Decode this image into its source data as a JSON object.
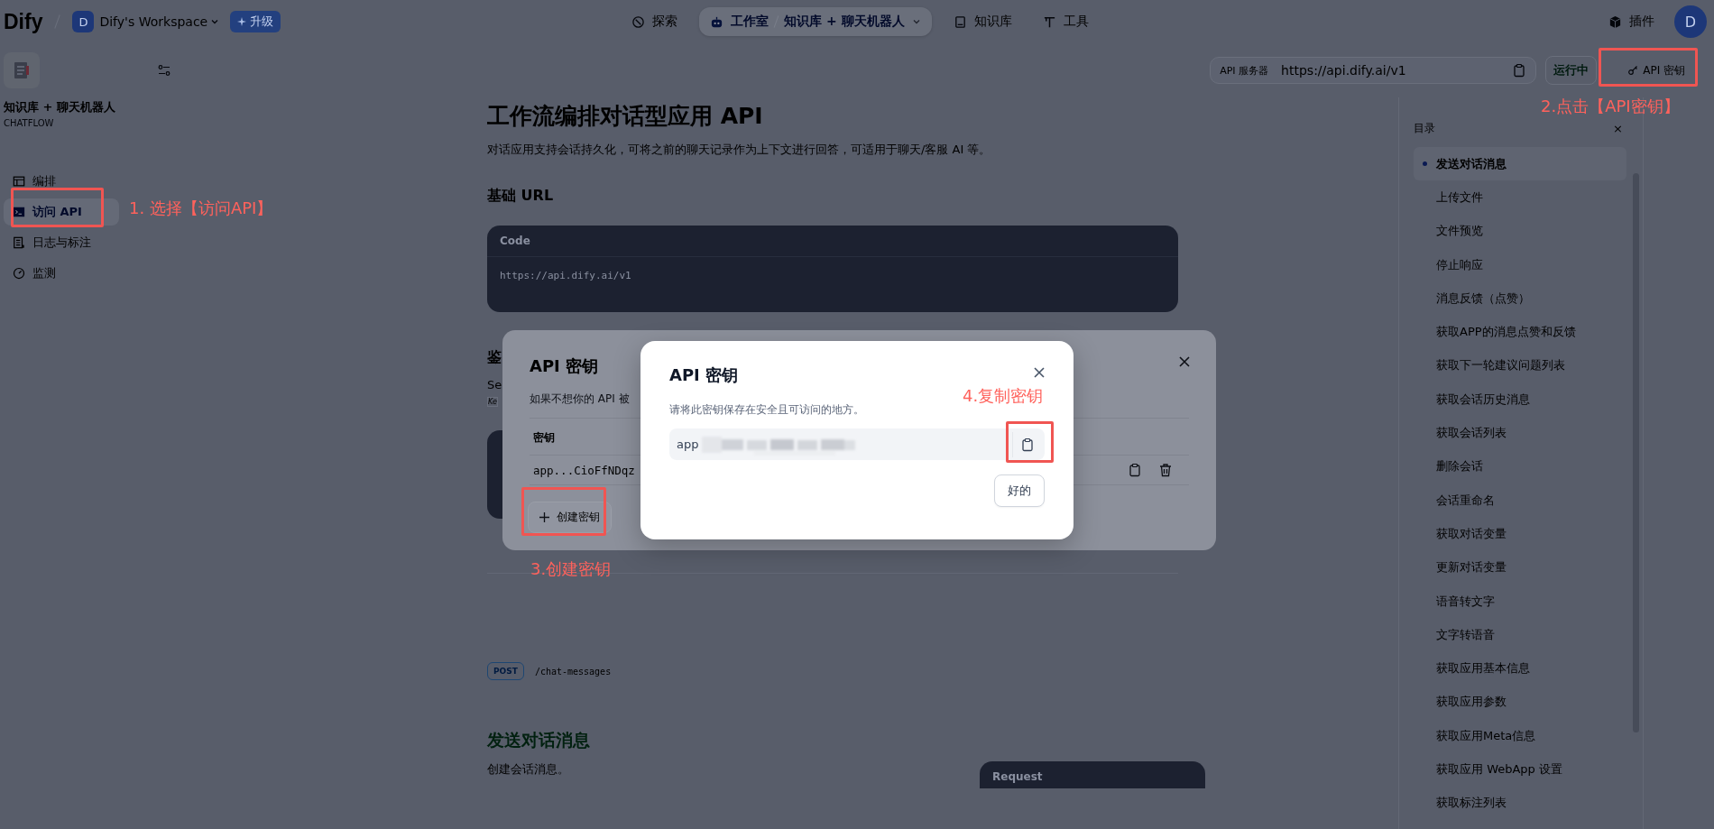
{
  "top_bar": {
    "logo": "Dify",
    "workspace_initial": "D",
    "workspace": "Dify's Workspace",
    "upgrade": "升级",
    "nav": [
      {
        "label": "探索",
        "selected": false
      },
      {
        "label": "工作室",
        "selected": true,
        "app": "知识库 + 聊天机器人"
      },
      {
        "label": "知识库",
        "selected": false
      },
      {
        "label": "工具",
        "selected": false
      }
    ],
    "plugins": "插件",
    "avatar": "D"
  },
  "sidebar": {
    "app_name": "知识库 + 聊天机器人",
    "app_type": "CHATFLOW",
    "items": [
      {
        "label": "编排",
        "selected": false
      },
      {
        "label": "访问 API",
        "selected": true
      },
      {
        "label": "日志与标注",
        "selected": false
      },
      {
        "label": "监测",
        "selected": false
      }
    ]
  },
  "api_bar": {
    "label": "API 服务器",
    "url": "https://api.dify.ai/v1",
    "status": "运行中",
    "key_button": "API 密钥"
  },
  "doc": {
    "title": "工作流编排对话型应用 API",
    "description": "对话应用支持会话持久化，可将之前的聊天记录作为上下文进行回答，可适用于聊天/客服 AI 等。",
    "base_url_heading": "基础 URL",
    "code": {
      "header": "Code",
      "body": "https://api.dify.ai/v1"
    },
    "auth_heading": "鉴",
    "auth_text": "Se",
    "auth_code": "Ke",
    "endpoint": {
      "method": "POST",
      "path": "/chat-messages"
    },
    "section_heading": "发送对话消息",
    "section_text": "创建会话消息。",
    "request_header": "Request"
  },
  "toc": {
    "title": "目录",
    "close": "×",
    "items": [
      {
        "label": "发送对话消息",
        "selected": true
      },
      {
        "label": "上传文件",
        "selected": false
      },
      {
        "label": "文件预览",
        "selected": false
      },
      {
        "label": "停止响应",
        "selected": false
      },
      {
        "label": "消息反馈（点赞）",
        "selected": false
      },
      {
        "label": "获取APP的消息点赞和反馈",
        "selected": false
      },
      {
        "label": "获取下一轮建议问题列表",
        "selected": false
      },
      {
        "label": "获取会话历史消息",
        "selected": false
      },
      {
        "label": "获取会话列表",
        "selected": false
      },
      {
        "label": "删除会话",
        "selected": false
      },
      {
        "label": "会话重命名",
        "selected": false
      },
      {
        "label": "获取对话变量",
        "selected": false
      },
      {
        "label": "更新对话变量",
        "selected": false
      },
      {
        "label": "语音转文字",
        "selected": false
      },
      {
        "label": "文字转语音",
        "selected": false
      },
      {
        "label": "获取应用基本信息",
        "selected": false
      },
      {
        "label": "获取应用参数",
        "selected": false
      },
      {
        "label": "获取应用Meta信息",
        "selected": false
      },
      {
        "label": "获取应用 WebApp 设置",
        "selected": false
      },
      {
        "label": "获取标注列表",
        "selected": false
      }
    ]
  },
  "key_list_modal": {
    "title": "API 密钥",
    "description": "如果不想你的 API 被",
    "column": "密钥",
    "keys": [
      "app...CioFfNDqz"
    ],
    "create_button": "创建密钥"
  },
  "new_key_dialog": {
    "title": "API 密钥",
    "description": "请将此密钥保存在安全且可访问的地方。",
    "key_prefix": "app",
    "ok_button": "好的"
  },
  "annotations": [
    {
      "text": "1. 选择【访问API】"
    },
    {
      "text": "2.点击【API密钥】"
    },
    {
      "text": "3.创建密钥"
    },
    {
      "text": "4.复制密钥"
    }
  ]
}
